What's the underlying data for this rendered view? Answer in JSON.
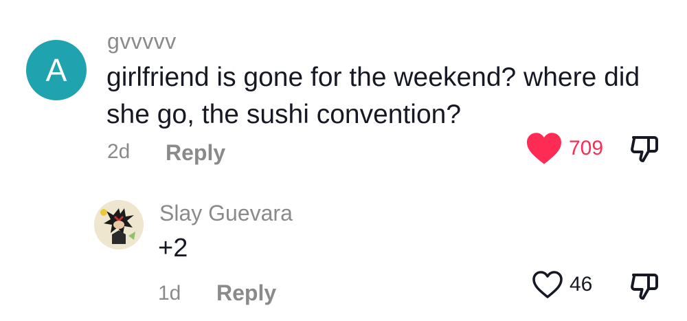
{
  "comment": {
    "avatar_letter": "A",
    "avatar_color": "#1fa3ae",
    "username": "gvvvvv",
    "text": "girlfriend is gone for the weekend? where did she go, the sushi convention?",
    "time": "2d",
    "reply_label": "Reply",
    "like_count": "709",
    "liked": true,
    "like_icon": "heart-filled-icon",
    "dislike_icon": "thumbs-down-icon"
  },
  "reply": {
    "avatar_icon": "user-avatar-drawing",
    "username": "Slay Guevara",
    "text": "+2",
    "time": "1d",
    "reply_label": "Reply",
    "like_count": "46",
    "liked": false,
    "like_icon": "heart-outline-icon",
    "dislike_icon": "thumbs-down-icon"
  },
  "colors": {
    "like_active": "#fe2c55",
    "muted_text": "#8a8a8a",
    "primary_text": "#161823"
  }
}
